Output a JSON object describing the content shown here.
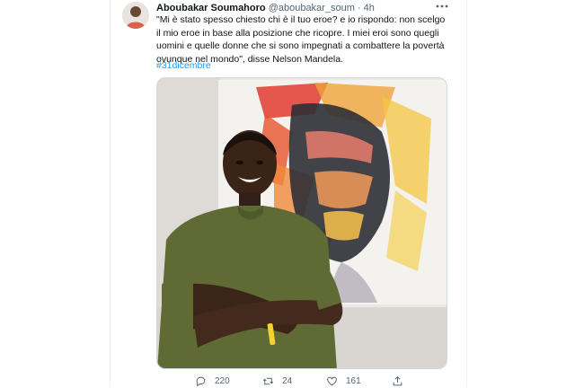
{
  "tweet": {
    "author_name": "Aboubakar Soumahoro",
    "handle": "@aboubakar_soum",
    "separator": "·",
    "time": "4h",
    "more_icon": "more-horizontal-icon",
    "text": "\"Mi è stato spesso chiesto chi è il tuo eroe? e io rispondo: non scelgo il mio eroe in base alla posizione che ricopre. I miei eroi sono quegli uomini e quelle donne che si sono impegnati a combattere la povertà ovunque nel mondo\", disse Nelson Mandela.",
    "hashtag": "#31dicembre"
  },
  "actions": {
    "reply_icon": "reply-icon",
    "reply_count": "220",
    "retweet_icon": "retweet-icon",
    "retweet_count": "24",
    "like_icon": "heart-icon",
    "like_count": "161",
    "share_icon": "share-icon"
  },
  "colors": {
    "link": "#1d9bf0",
    "secondary_text": "#536471",
    "primary_text": "#0f1419"
  }
}
